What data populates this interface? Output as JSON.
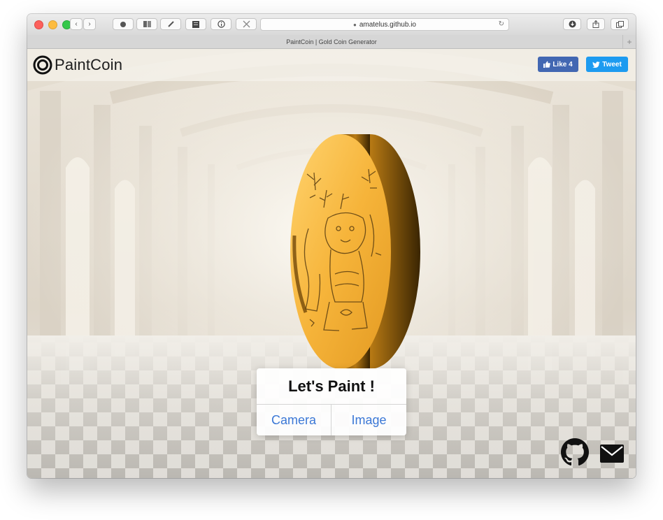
{
  "browser": {
    "address": "amatelus.github.io",
    "tab_title": "PaintCoin | Gold Coin Generator"
  },
  "header": {
    "brand": "PaintCoin",
    "like_label": "Like 4",
    "tweet_label": "Tweet"
  },
  "panel": {
    "title": "Let's Paint !",
    "camera_label": "Camera",
    "image_label": "Image"
  },
  "icons": {
    "back": "chevron-left-icon",
    "forward": "chevron-right-icon",
    "github": "github-icon",
    "mail": "mail-icon"
  },
  "colors": {
    "facebook": "#4267b2",
    "twitter": "#1d9bf0",
    "button_text": "#3b78d6",
    "coin_gold": "#f2b43a"
  }
}
